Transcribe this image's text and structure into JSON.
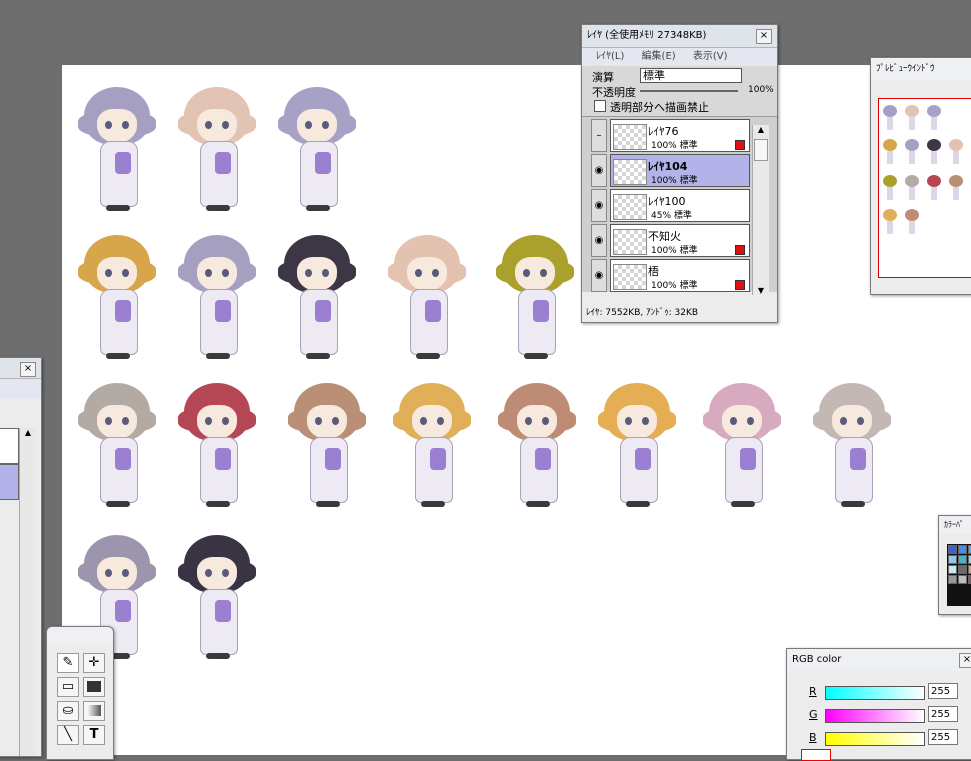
{
  "layer_window": {
    "title": "ﾚｲﾔ (全使用ﾒﾓﾘ 27348KB)",
    "menu": [
      "ﾚｲﾔ(L)",
      "編集(E)",
      "表示(V)"
    ],
    "blend_label": "演算",
    "blend_value": "標準",
    "opacity_label": "不透明度",
    "opacity_value": "100%",
    "protect_label": "透明部分へ描画禁止",
    "layers": [
      {
        "name": "ﾚｲﾔ76",
        "info": "100% 標準",
        "visible": false,
        "locked": true,
        "selected": false
      },
      {
        "name": "ﾚｲﾔ104",
        "info": "100% 標準",
        "visible": true,
        "locked": false,
        "selected": true
      },
      {
        "name": "ﾚｲﾔ100",
        "info": "45% 標準",
        "visible": true,
        "locked": false,
        "selected": false
      },
      {
        "name": "不知火",
        "info": "100% 標準",
        "visible": true,
        "locked": true,
        "selected": false
      },
      {
        "name": "梧",
        "info": "100% 標準",
        "visible": true,
        "locked": true,
        "selected": false
      }
    ],
    "status": "ﾚｲﾔ: 7552KB, ｱﾝﾄﾞｩ: 32KB"
  },
  "preview_window": {
    "title": "ﾌﾟﾚﾋﾞｭｰｳｲﾝﾄﾞｳ"
  },
  "palette_window": {
    "title": "ｶﾗｰﾊﾟ"
  },
  "rgb_window": {
    "title": "RGB color",
    "channels": [
      {
        "label": "R",
        "value": "255",
        "color": "#00ffff"
      },
      {
        "label": "G",
        "value": "255",
        "color": "#ff00ff"
      },
      {
        "label": "B",
        "value": "255",
        "color": "#ffff00"
      }
    ]
  },
  "tool_window": {
    "icons": [
      "pen-icon",
      "move-icon",
      "select-icon",
      "fill-rect-icon",
      "bucket-icon",
      "gradient-icon",
      "line-icon",
      "text-icon"
    ]
  },
  "canvas": {
    "characters": [
      {
        "hair": "#a59fc2"
      },
      {
        "hair": "#e2c3b4"
      },
      {
        "hair": "#a7a1c6"
      },
      {
        "hair": "#d8a64a"
      },
      {
        "hair": "#a5a0bf"
      },
      {
        "hair": "#3c3645"
      },
      {
        "hair": "#e3c2b0"
      },
      {
        "hair": "#a9a12c"
      },
      {
        "hair": "#b2aaa3"
      },
      {
        "hair": "#b54754"
      },
      {
        "hair": "#b98f75"
      },
      {
        "hair": "#dfb058"
      },
      {
        "hair": "#be8c74"
      },
      {
        "hair": "#e5ae55"
      },
      {
        "hair": "#d7aac0"
      },
      {
        "hair": "#c4b8b4"
      },
      {
        "hair": "#9d95ad"
      },
      {
        "hair": "#3a3343"
      }
    ],
    "palette_colors": [
      "#3a63c9",
      "#4f88e0",
      "#5fa3e8",
      "#8fc7ee",
      "#49b1c7",
      "#9ad7e3",
      "#c9e9ef",
      "#6a6a6a",
      "#d9a48f",
      "#999999",
      "#bdbdbd",
      "#7b5f5f"
    ]
  }
}
